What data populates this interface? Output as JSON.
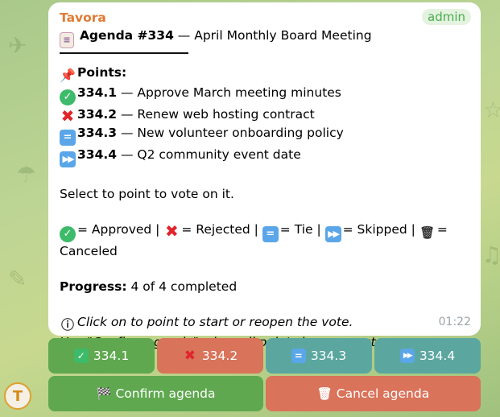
{
  "message": {
    "sender": "Tavora",
    "badge": "admin",
    "agenda_id_label": "Agenda #334",
    "agenda_title": " — April Monthly Board Meeting",
    "points_header": "Points:",
    "points": [
      {
        "id": "334.1",
        "title": " — Approve March meeting minutes",
        "status": "approved"
      },
      {
        "id": "334.2",
        "title": " — Renew web hosting contract",
        "status": "rejected"
      },
      {
        "id": "334.3",
        "title": " — New volunteer onboarding policy",
        "status": "tie"
      },
      {
        "id": "334.4",
        "title": " — Q2 community event date",
        "status": "skipped"
      }
    ],
    "instruction": "Select to point to vote on it.",
    "legend": {
      "approved": "= Approved |",
      "rejected": "= Rejected |",
      "tie": "= Tie |",
      "skipped": "= Skipped |",
      "canceled": "=",
      "canceled_word": "Canceled"
    },
    "progress_label": "Progress:",
    "progress_value": " 4 of 4 completed",
    "hint_line1": "Click on to point to start or reopen the vote.",
    "hint_line2": "Use \"Confirm agenda\" when all points have an outcome.",
    "time": "01:22"
  },
  "keyboard": {
    "point_buttons": [
      "334.1",
      "334.2",
      "334.3",
      "334.4"
    ],
    "confirm_label": "Confirm agenda",
    "cancel_label": "Cancel agenda"
  },
  "icons": {
    "approved": "check-circle-icon",
    "rejected": "cross-mark-icon",
    "tie": "equals-square-icon",
    "skipped": "fast-forward-icon",
    "canceled": "trash-icon"
  },
  "colors": {
    "sender": "#e07a33",
    "badge": "#4bab52",
    "button_green": "#5fa84f",
    "button_red": "#d9735a",
    "button_teal": "#5ba7a0"
  },
  "avatar_letter": "T"
}
